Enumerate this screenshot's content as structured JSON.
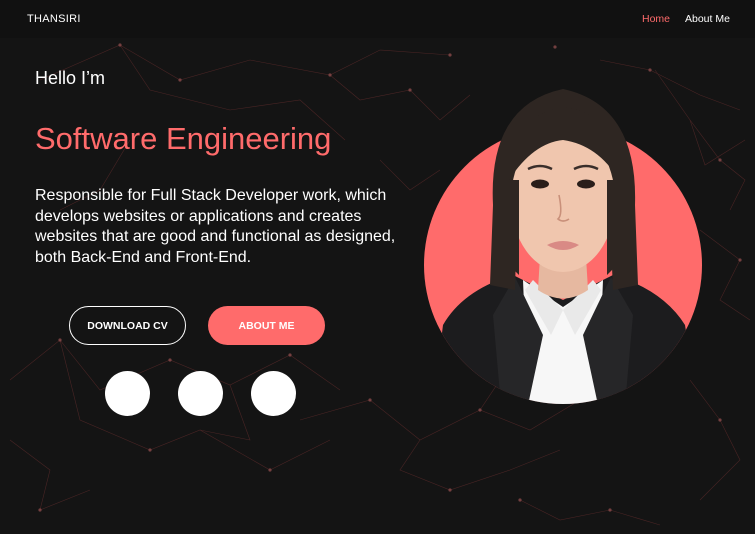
{
  "nav": {
    "brand": "THANSIRI",
    "links": [
      {
        "label": "Home",
        "active": true
      },
      {
        "label": "About Me",
        "active": false
      }
    ]
  },
  "hero": {
    "greeting": "Hello I’m",
    "title": "Software Engineering",
    "description": "Responsible for Full Stack Developer work, which develops websites or applications and creates websites that are good and functional as designed, both Back-End and Front-End.",
    "buttons": {
      "download_cv": "DOWNLOAD CV",
      "about_me": "ABOUT ME"
    },
    "social_icons": [
      "social-icon-1",
      "social-icon-2",
      "social-icon-3"
    ]
  },
  "colors": {
    "background": "#141414",
    "navbar": "#111111",
    "accent": "#ff6b6b",
    "text": "#ffffff"
  }
}
